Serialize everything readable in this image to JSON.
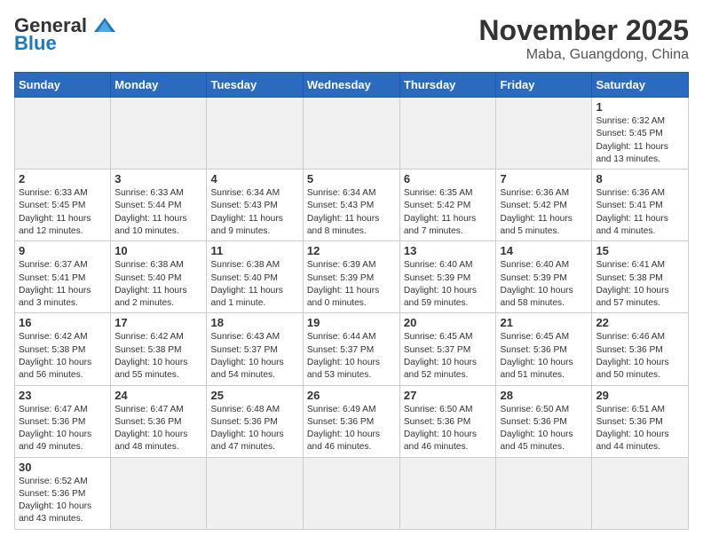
{
  "logo": {
    "general": "General",
    "blue": "Blue"
  },
  "title": "November 2025",
  "subtitle": "Maba, Guangdong, China",
  "weekdays": [
    "Sunday",
    "Monday",
    "Tuesday",
    "Wednesday",
    "Thursday",
    "Friday",
    "Saturday"
  ],
  "weeks": [
    [
      {
        "day": "",
        "empty": true
      },
      {
        "day": "",
        "empty": true
      },
      {
        "day": "",
        "empty": true
      },
      {
        "day": "",
        "empty": true
      },
      {
        "day": "",
        "empty": true
      },
      {
        "day": "",
        "empty": true
      },
      {
        "day": "1",
        "sunrise": "Sunrise: 6:32 AM",
        "sunset": "Sunset: 5:45 PM",
        "daylight": "Daylight: 11 hours and 13 minutes."
      }
    ],
    [
      {
        "day": "2",
        "sunrise": "Sunrise: 6:33 AM",
        "sunset": "Sunset: 5:45 PM",
        "daylight": "Daylight: 11 hours and 12 minutes."
      },
      {
        "day": "3",
        "sunrise": "Sunrise: 6:33 AM",
        "sunset": "Sunset: 5:44 PM",
        "daylight": "Daylight: 11 hours and 10 minutes."
      },
      {
        "day": "4",
        "sunrise": "Sunrise: 6:34 AM",
        "sunset": "Sunset: 5:43 PM",
        "daylight": "Daylight: 11 hours and 9 minutes."
      },
      {
        "day": "5",
        "sunrise": "Sunrise: 6:34 AM",
        "sunset": "Sunset: 5:43 PM",
        "daylight": "Daylight: 11 hours and 8 minutes."
      },
      {
        "day": "6",
        "sunrise": "Sunrise: 6:35 AM",
        "sunset": "Sunset: 5:42 PM",
        "daylight": "Daylight: 11 hours and 7 minutes."
      },
      {
        "day": "7",
        "sunrise": "Sunrise: 6:36 AM",
        "sunset": "Sunset: 5:42 PM",
        "daylight": "Daylight: 11 hours and 5 minutes."
      },
      {
        "day": "8",
        "sunrise": "Sunrise: 6:36 AM",
        "sunset": "Sunset: 5:41 PM",
        "daylight": "Daylight: 11 hours and 4 minutes."
      }
    ],
    [
      {
        "day": "9",
        "sunrise": "Sunrise: 6:37 AM",
        "sunset": "Sunset: 5:41 PM",
        "daylight": "Daylight: 11 hours and 3 minutes."
      },
      {
        "day": "10",
        "sunrise": "Sunrise: 6:38 AM",
        "sunset": "Sunset: 5:40 PM",
        "daylight": "Daylight: 11 hours and 2 minutes."
      },
      {
        "day": "11",
        "sunrise": "Sunrise: 6:38 AM",
        "sunset": "Sunset: 5:40 PM",
        "daylight": "Daylight: 11 hours and 1 minute."
      },
      {
        "day": "12",
        "sunrise": "Sunrise: 6:39 AM",
        "sunset": "Sunset: 5:39 PM",
        "daylight": "Daylight: 11 hours and 0 minutes."
      },
      {
        "day": "13",
        "sunrise": "Sunrise: 6:40 AM",
        "sunset": "Sunset: 5:39 PM",
        "daylight": "Daylight: 10 hours and 59 minutes."
      },
      {
        "day": "14",
        "sunrise": "Sunrise: 6:40 AM",
        "sunset": "Sunset: 5:39 PM",
        "daylight": "Daylight: 10 hours and 58 minutes."
      },
      {
        "day": "15",
        "sunrise": "Sunrise: 6:41 AM",
        "sunset": "Sunset: 5:38 PM",
        "daylight": "Daylight: 10 hours and 57 minutes."
      }
    ],
    [
      {
        "day": "16",
        "sunrise": "Sunrise: 6:42 AM",
        "sunset": "Sunset: 5:38 PM",
        "daylight": "Daylight: 10 hours and 56 minutes."
      },
      {
        "day": "17",
        "sunrise": "Sunrise: 6:42 AM",
        "sunset": "Sunset: 5:38 PM",
        "daylight": "Daylight: 10 hours and 55 minutes."
      },
      {
        "day": "18",
        "sunrise": "Sunrise: 6:43 AM",
        "sunset": "Sunset: 5:37 PM",
        "daylight": "Daylight: 10 hours and 54 minutes."
      },
      {
        "day": "19",
        "sunrise": "Sunrise: 6:44 AM",
        "sunset": "Sunset: 5:37 PM",
        "daylight": "Daylight: 10 hours and 53 minutes."
      },
      {
        "day": "20",
        "sunrise": "Sunrise: 6:45 AM",
        "sunset": "Sunset: 5:37 PM",
        "daylight": "Daylight: 10 hours and 52 minutes."
      },
      {
        "day": "21",
        "sunrise": "Sunrise: 6:45 AM",
        "sunset": "Sunset: 5:36 PM",
        "daylight": "Daylight: 10 hours and 51 minutes."
      },
      {
        "day": "22",
        "sunrise": "Sunrise: 6:46 AM",
        "sunset": "Sunset: 5:36 PM",
        "daylight": "Daylight: 10 hours and 50 minutes."
      }
    ],
    [
      {
        "day": "23",
        "sunrise": "Sunrise: 6:47 AM",
        "sunset": "Sunset: 5:36 PM",
        "daylight": "Daylight: 10 hours and 49 minutes."
      },
      {
        "day": "24",
        "sunrise": "Sunrise: 6:47 AM",
        "sunset": "Sunset: 5:36 PM",
        "daylight": "Daylight: 10 hours and 48 minutes."
      },
      {
        "day": "25",
        "sunrise": "Sunrise: 6:48 AM",
        "sunset": "Sunset: 5:36 PM",
        "daylight": "Daylight: 10 hours and 47 minutes."
      },
      {
        "day": "26",
        "sunrise": "Sunrise: 6:49 AM",
        "sunset": "Sunset: 5:36 PM",
        "daylight": "Daylight: 10 hours and 46 minutes."
      },
      {
        "day": "27",
        "sunrise": "Sunrise: 6:50 AM",
        "sunset": "Sunset: 5:36 PM",
        "daylight": "Daylight: 10 hours and 46 minutes."
      },
      {
        "day": "28",
        "sunrise": "Sunrise: 6:50 AM",
        "sunset": "Sunset: 5:36 PM",
        "daylight": "Daylight: 10 hours and 45 minutes."
      },
      {
        "day": "29",
        "sunrise": "Sunrise: 6:51 AM",
        "sunset": "Sunset: 5:36 PM",
        "daylight": "Daylight: 10 hours and 44 minutes."
      }
    ],
    [
      {
        "day": "30",
        "sunrise": "Sunrise: 6:52 AM",
        "sunset": "Sunset: 5:36 PM",
        "daylight": "Daylight: 10 hours and 43 minutes."
      },
      {
        "day": "",
        "empty": true
      },
      {
        "day": "",
        "empty": true
      },
      {
        "day": "",
        "empty": true
      },
      {
        "day": "",
        "empty": true
      },
      {
        "day": "",
        "empty": true
      },
      {
        "day": "",
        "empty": true
      }
    ]
  ]
}
